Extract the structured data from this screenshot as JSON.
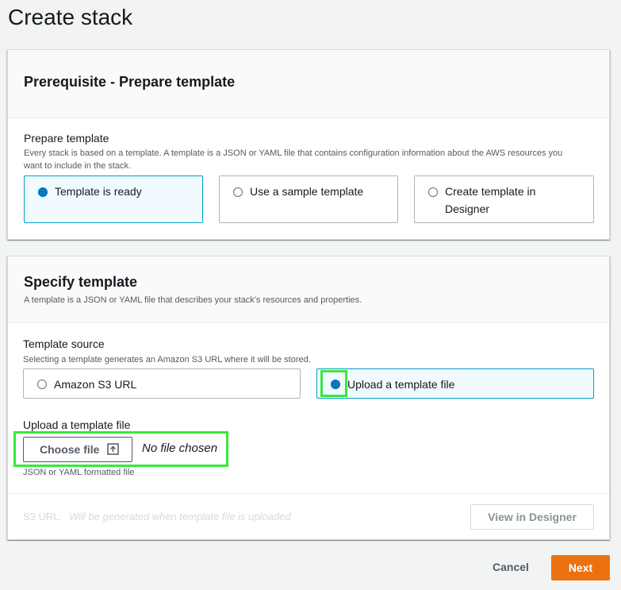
{
  "page": {
    "title": "Create stack"
  },
  "prerequisite": {
    "header": "Prerequisite - Prepare template",
    "field_label": "Prepare template",
    "field_desc": "Every stack is based on a template. A template is a JSON or YAML file that contains configuration information about the AWS resources you want to include in the stack.",
    "options": [
      {
        "label": "Template is ready",
        "selected": true
      },
      {
        "label": "Use a sample template",
        "selected": false
      },
      {
        "label": "Create template in Designer",
        "selected": false
      }
    ]
  },
  "specify": {
    "header": "Specify template",
    "desc": "A template is a JSON or YAML file that describes your stack's resources and properties.",
    "source_label": "Template source",
    "source_desc": "Selecting a template generates an Amazon S3 URL where it will be stored.",
    "source_options": [
      {
        "label": "Amazon S3 URL",
        "selected": false
      },
      {
        "label": "Upload a template file",
        "selected": true
      }
    ],
    "upload_label": "Upload a template file",
    "choose_file_label": "Choose file",
    "no_file_text": "No file chosen",
    "upload_hint": "JSON or YAML formatted file",
    "s3_url_label": "S3 URL:",
    "s3_url_placeholder": "Will be generated when template file is uploaded",
    "view_designer_label": "View in Designer"
  },
  "footer": {
    "cancel_label": "Cancel",
    "next_label": "Next"
  },
  "colors": {
    "accent": "#0073bb",
    "primary_button": "#ec7211",
    "highlight": "#39e83a",
    "selected_tile_bg": "#f1faff"
  }
}
